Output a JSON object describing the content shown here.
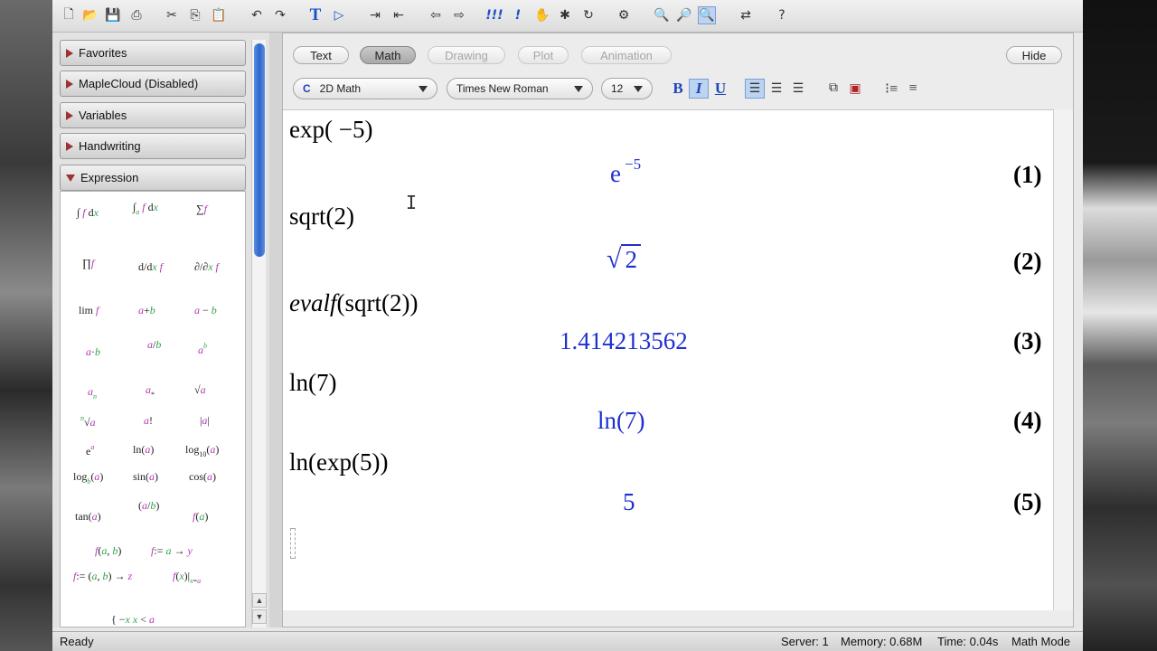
{
  "toolbar": {
    "icons": [
      "new-icon",
      "open-icon",
      "save-icon",
      "print-icon",
      "cut-icon",
      "copy-icon",
      "paste-icon",
      "undo-icon",
      "redo-icon",
      "text-icon",
      "prompt-icon",
      "indent-icon",
      "outdent-icon",
      "back-icon",
      "forward-icon",
      "execute-all-icon",
      "execute-icon",
      "stop-icon",
      "debug-icon",
      "restart-icon",
      "settings-icon",
      "zoom-in-icon",
      "zoom-out-icon",
      "zoom-fit-icon",
      "toggle-icon",
      "help-icon"
    ]
  },
  "palettes": {
    "favorites": "Favorites",
    "maplecloud": "MapleCloud (Disabled)",
    "variables": "Variables",
    "handwriting": "Handwriting",
    "expression": "Expression"
  },
  "mode_tabs": {
    "text": "Text",
    "math": "Math",
    "drawing": "Drawing",
    "plot": "Plot",
    "animation": "Animation",
    "hide": "Hide"
  },
  "format_bar": {
    "style_icon": "C",
    "style": "2D Math",
    "font": "Times New Roman",
    "size": "12",
    "bold": "B",
    "italic": "I",
    "underline": "U"
  },
  "worksheet": {
    "entries": [
      {
        "input": "exp( −5)",
        "output_base": "e",
        "output_sup": "−5",
        "label": "(1)"
      },
      {
        "input": "sqrt(2)",
        "output": "2",
        "label": "(2)"
      },
      {
        "input_func": "evalf",
        "input_rest": "(sqrt(2))",
        "output": "1.414213562",
        "label": "(3)"
      },
      {
        "input": "ln(7)",
        "output": "ln(7)",
        "label": "(4)"
      },
      {
        "input": "ln(exp(5))",
        "output": "5",
        "label": "(5)"
      }
    ]
  },
  "status": {
    "ready": "Ready",
    "server": "Server: 1",
    "memory": "Memory: 0.68M",
    "time": "Time: 0.04s",
    "mode": "Math Mode"
  }
}
